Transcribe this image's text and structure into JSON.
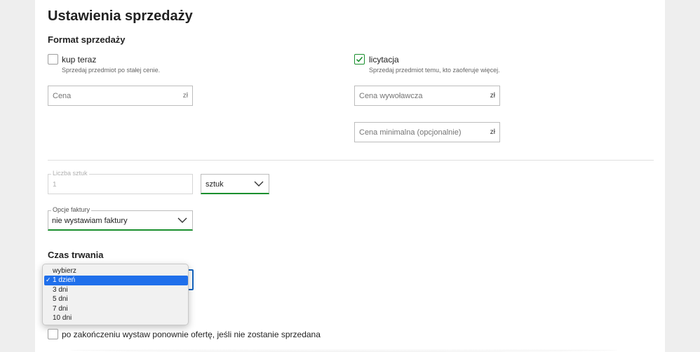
{
  "header": {
    "title": "Ustawienia sprzedaży"
  },
  "sale_format": {
    "title": "Format sprzedaży",
    "buy_now": {
      "label": "kup teraz",
      "help": "Sprzedaj przedmiot po stałej cenie.",
      "checked": false,
      "price_placeholder": "Cena",
      "currency": "zł"
    },
    "auction": {
      "label": "licytacja",
      "help": "Sprzedaj przedmiot temu, kto zaoferuje więcej.",
      "checked": true,
      "start_price_placeholder": "Cena wywoławcza",
      "min_price_placeholder": "Cena minimalna (opcjonalnie)",
      "currency": "zł"
    }
  },
  "quantity": {
    "label": "Liczba sztuk",
    "value": "1",
    "unit_selected": "sztuk"
  },
  "invoice": {
    "label": "Opcje faktury",
    "selected": "nie wystawiam faktury"
  },
  "duration": {
    "title": "Czas trwania",
    "options": [
      "wybierz",
      "1 dzień",
      "3 dni",
      "5 dni",
      "7 dni",
      "10 dni"
    ],
    "selected_index": 1,
    "check_mark": "✓"
  },
  "relist": {
    "label": "po zakończeniu wystaw ponownie ofertę, jeśli nie zostanie sprzedana",
    "checked": false
  },
  "colors": {
    "accent_green": "#1a8f2e",
    "focus_blue": "#1565c0",
    "highlight_blue": "#1f6feb"
  }
}
